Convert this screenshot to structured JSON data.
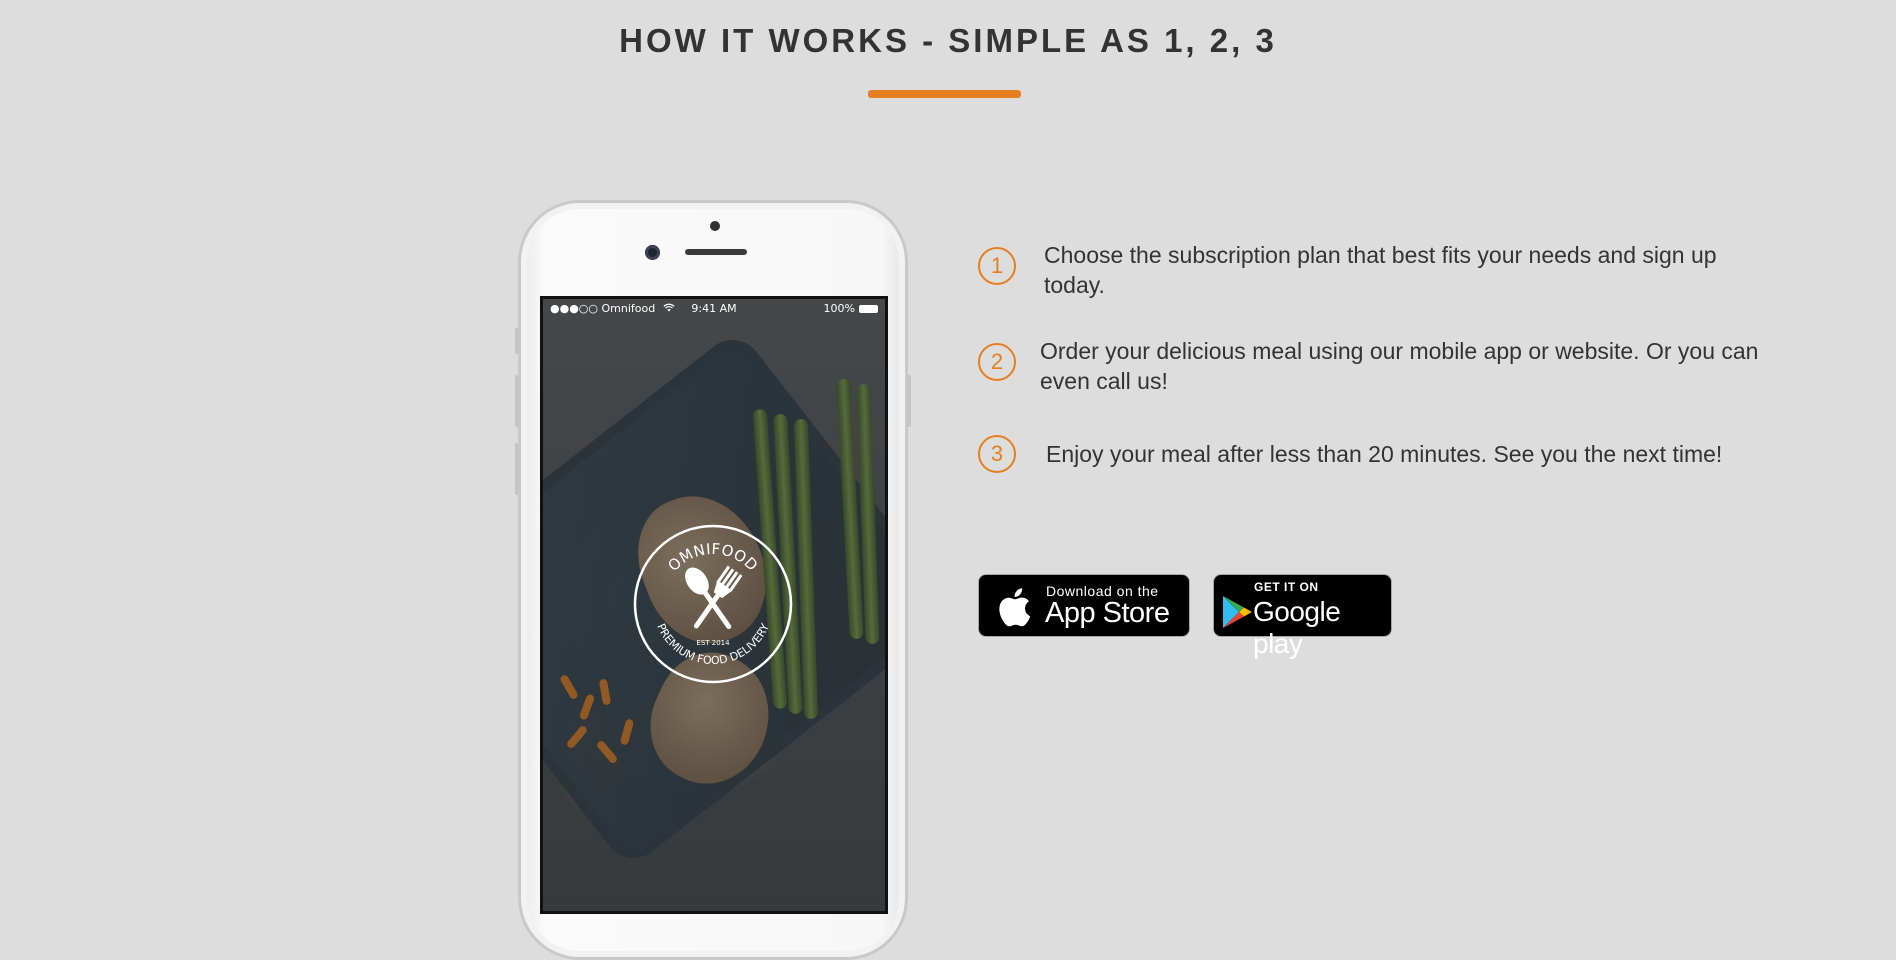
{
  "section": {
    "title": "HOW IT WORKS - SIMPLE AS 1, 2, 3",
    "accent_color": "#e67e22"
  },
  "phone": {
    "status_bar": {
      "carrier": "●●●○○ Omnifood",
      "time": "9:41 AM",
      "battery": "100%"
    },
    "logo": {
      "brand": "OMNIFOOD",
      "established": "EST 2014",
      "tagline": "PREMIUM FOOD DELIVERY"
    }
  },
  "steps": [
    {
      "number": "1",
      "text": "Choose the subscription plan that best fits your needs and sign up today."
    },
    {
      "number": "2",
      "text": "Order your delicious meal using our mobile app or website. Or you can even call us!"
    },
    {
      "number": "3",
      "text": "Enjoy your meal after less than 20 minutes. See you the next time!"
    }
  ],
  "badges": {
    "app_store": {
      "small": "Download on the",
      "big": "App Store",
      "icon": "apple-icon"
    },
    "google_play": {
      "small": "GET IT ON",
      "big": "Google play",
      "icon": "google-play-icon"
    }
  }
}
